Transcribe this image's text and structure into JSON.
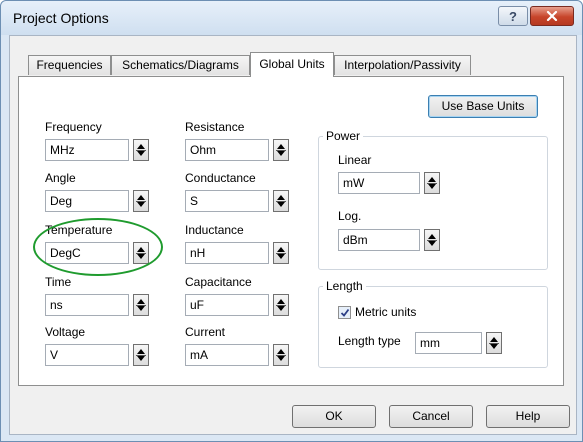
{
  "window": {
    "title": "Project Options"
  },
  "titlebar": {
    "help_label": "?"
  },
  "tabs": [
    {
      "label": "Frequencies"
    },
    {
      "label": "Schematics/Diagrams"
    },
    {
      "label": "Global Units"
    },
    {
      "label": "Interpolation/Passivity"
    }
  ],
  "active_tab": "Global Units",
  "use_base_units_label": "Use Base Units",
  "units_left": {
    "frequency": {
      "label": "Frequency",
      "value": "MHz"
    },
    "angle": {
      "label": "Angle",
      "value": "Deg"
    },
    "temperature": {
      "label": "Temperature",
      "value": "DegC"
    },
    "time": {
      "label": "Time",
      "value": "ns"
    },
    "voltage": {
      "label": "Voltage",
      "value": "V"
    }
  },
  "units_mid": {
    "resistance": {
      "label": "Resistance",
      "value": "Ohm"
    },
    "conductance": {
      "label": "Conductance",
      "value": "S"
    },
    "inductance": {
      "label": "Inductance",
      "value": "nH"
    },
    "capacitance": {
      "label": "Capacitance",
      "value": "uF"
    },
    "current": {
      "label": "Current",
      "value": "mA"
    }
  },
  "power": {
    "title": "Power",
    "linear": {
      "label": "Linear",
      "value": "mW"
    },
    "log": {
      "label": "Log.",
      "value": "dBm"
    }
  },
  "length": {
    "title": "Length",
    "metric_units": {
      "label": "Metric units",
      "checked": true
    },
    "length_type": {
      "label": "Length type",
      "value": "mm"
    }
  },
  "buttons": {
    "ok": "OK",
    "cancel": "Cancel",
    "help": "Help"
  },
  "colors": {
    "annotation_ellipse": "#1f9b2e",
    "close_button": "#c7452b"
  }
}
